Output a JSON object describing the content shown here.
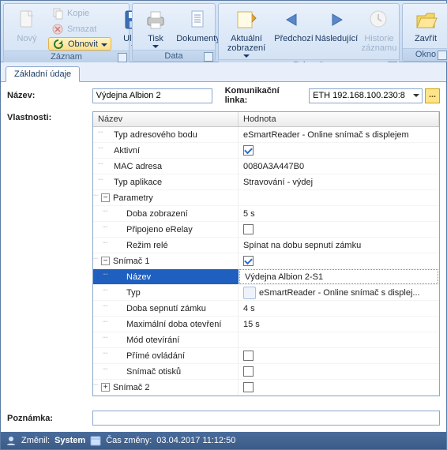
{
  "ribbon": {
    "groups": {
      "zaznam": {
        "title": "Záznam"
      },
      "data": {
        "title": "Data"
      },
      "zobrazit": {
        "title": "Zobrazit"
      },
      "okno": {
        "title": "Okno"
      }
    },
    "btn": {
      "novy": "Nový",
      "kopie": "Kopie",
      "smazat": "Smazat",
      "obnovit": "Obnovit",
      "ulozit": "Uložit",
      "tisk": "Tisk",
      "dokumenty": "Dokumenty",
      "aktualni": "Aktuální\nzobrazení",
      "predchozi": "Předchozí",
      "nasledujici": "Následující",
      "historie": "Historie\nzáznamu",
      "zavrit": "Zavřít"
    }
  },
  "tabs": {
    "basic": "Základní údaje"
  },
  "form": {
    "name_label": "Název:",
    "name_value": "Výdejna Albion 2",
    "link_label": "Komunikační linka:",
    "link_value": "ETH 192.168.100.230:8",
    "dots": "...",
    "props_label": "Vlastnosti:",
    "note_label": "Poznámka:",
    "note_value": ""
  },
  "grid": {
    "head": {
      "name": "Název",
      "value": "Hodnota"
    },
    "rows": [
      {
        "depth": 1,
        "exp": "",
        "name": "Typ adresového bodu",
        "val": "eSmartReader - Online snímač s displejem"
      },
      {
        "depth": 1,
        "exp": "",
        "name": "Aktivní",
        "check": true
      },
      {
        "depth": 1,
        "exp": "",
        "name": "MAC adresa",
        "val": "0080A3A447B0"
      },
      {
        "depth": 1,
        "exp": "",
        "name": "Typ aplikace",
        "val": "Stravování - výdej"
      },
      {
        "depth": 0,
        "exp": "-",
        "name": "Parametry",
        "val": ""
      },
      {
        "depth": 2,
        "exp": "",
        "name": "Doba zobrazení",
        "val": "5 s"
      },
      {
        "depth": 2,
        "exp": "",
        "name": "Připojeno eRelay",
        "check": false
      },
      {
        "depth": 2,
        "exp": "",
        "name": "Režim relé",
        "val": "Spínat na dobu sepnutí zámku"
      },
      {
        "depth": 0,
        "exp": "-",
        "name": "Snímač 1",
        "check": true
      },
      {
        "depth": 2,
        "exp": "",
        "name": "Název",
        "val": "Výdejna Albion 2-S1",
        "selected": true,
        "editing": true
      },
      {
        "depth": 2,
        "exp": "",
        "name": "Typ",
        "val": "eSmartReader - Online snímač s displej...",
        "icon": true
      },
      {
        "depth": 2,
        "exp": "",
        "name": "Doba sepnutí zámku",
        "val": "4 s"
      },
      {
        "depth": 2,
        "exp": "",
        "name": "Maximální doba otevření",
        "val": "15 s"
      },
      {
        "depth": 2,
        "exp": "",
        "name": "Mód otevírání",
        "val": ""
      },
      {
        "depth": 2,
        "exp": "",
        "name": "Přímé ovládání",
        "check": false
      },
      {
        "depth": 2,
        "exp": "",
        "name": "Snímač otisků",
        "check": false
      },
      {
        "depth": 0,
        "exp": "+",
        "name": "Snímač 2",
        "check": false
      }
    ]
  },
  "status": {
    "changed_label": "Změnil:",
    "changed_value": "System",
    "time_label": "Čas změny:",
    "time_value": "03.04.2017 11:12:50"
  }
}
